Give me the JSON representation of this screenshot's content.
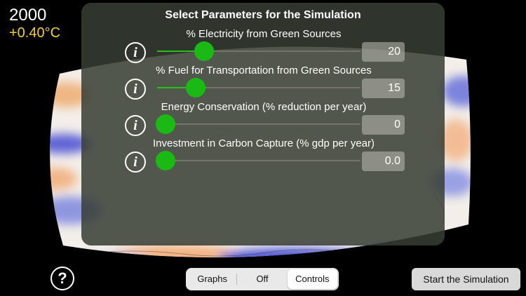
{
  "readout": {
    "year": "2000",
    "temperature": "+0.40°C"
  },
  "panel": {
    "title": "Select Parameters for the Simulation",
    "info_icon": "info-icon",
    "parameters": [
      {
        "label": "% Electricity from Green Sources",
        "value": "20",
        "slider_fraction": 0.23
      },
      {
        "label": "% Fuel for Transportation from Green Sources",
        "value": "15",
        "slider_fraction": 0.19
      },
      {
        "label": "Energy Conservation (% reduction per year)",
        "value": "0",
        "slider_fraction": 0.04
      },
      {
        "label": "Investment in Carbon Capture (% gdp per year)",
        "value": "0.0",
        "slider_fraction": 0.04
      }
    ]
  },
  "footer": {
    "help_icon": "question-icon",
    "help_label": "?",
    "segments": [
      {
        "label": "Graphs",
        "active": false
      },
      {
        "label": "Off",
        "active": false
      },
      {
        "label": "Controls",
        "active": true
      }
    ],
    "start_label": "Start the Simulation"
  },
  "colors": {
    "accent_green": "#1bb913",
    "temperature": "#f2cf2f",
    "warm_anomaly": "#f2b582",
    "cool_anomaly": "#6d73d8"
  }
}
